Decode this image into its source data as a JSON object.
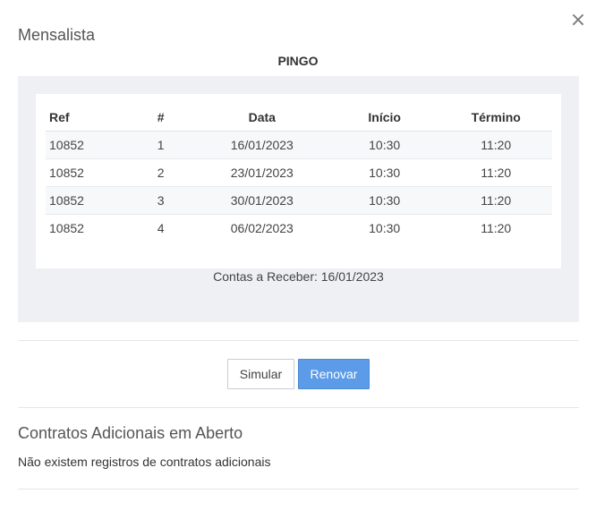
{
  "modal": {
    "title": "Mensalista",
    "close_icon": "×",
    "client_name": "PINGO"
  },
  "schedule_table": {
    "headers": {
      "ref": "Ref",
      "num": "#",
      "data": "Data",
      "inicio": "Início",
      "termino": "Término"
    },
    "rows": [
      {
        "ref": "10852",
        "num": "1",
        "data": "16/01/2023",
        "inicio": "10:30",
        "termino": "11:20"
      },
      {
        "ref": "10852",
        "num": "2",
        "data": "23/01/2023",
        "inicio": "10:30",
        "termino": "11:20"
      },
      {
        "ref": "10852",
        "num": "3",
        "data": "30/01/2023",
        "inicio": "10:30",
        "termino": "11:20"
      },
      {
        "ref": "10852",
        "num": "4",
        "data": "06/02/2023",
        "inicio": "10:30",
        "termino": "11:20"
      }
    ]
  },
  "contas_receber": "Contas a Receber: 16/01/2023",
  "actions": {
    "simular_label": "Simular",
    "renovar_label": "Renovar"
  },
  "contratos_adicionais": {
    "title": "Contratos Adicionais em Aberto",
    "empty_message": "Não existem registros de contratos adicionais"
  },
  "colors": {
    "primary_button": "#5b9be8",
    "panel_background": "#eef0f4"
  }
}
